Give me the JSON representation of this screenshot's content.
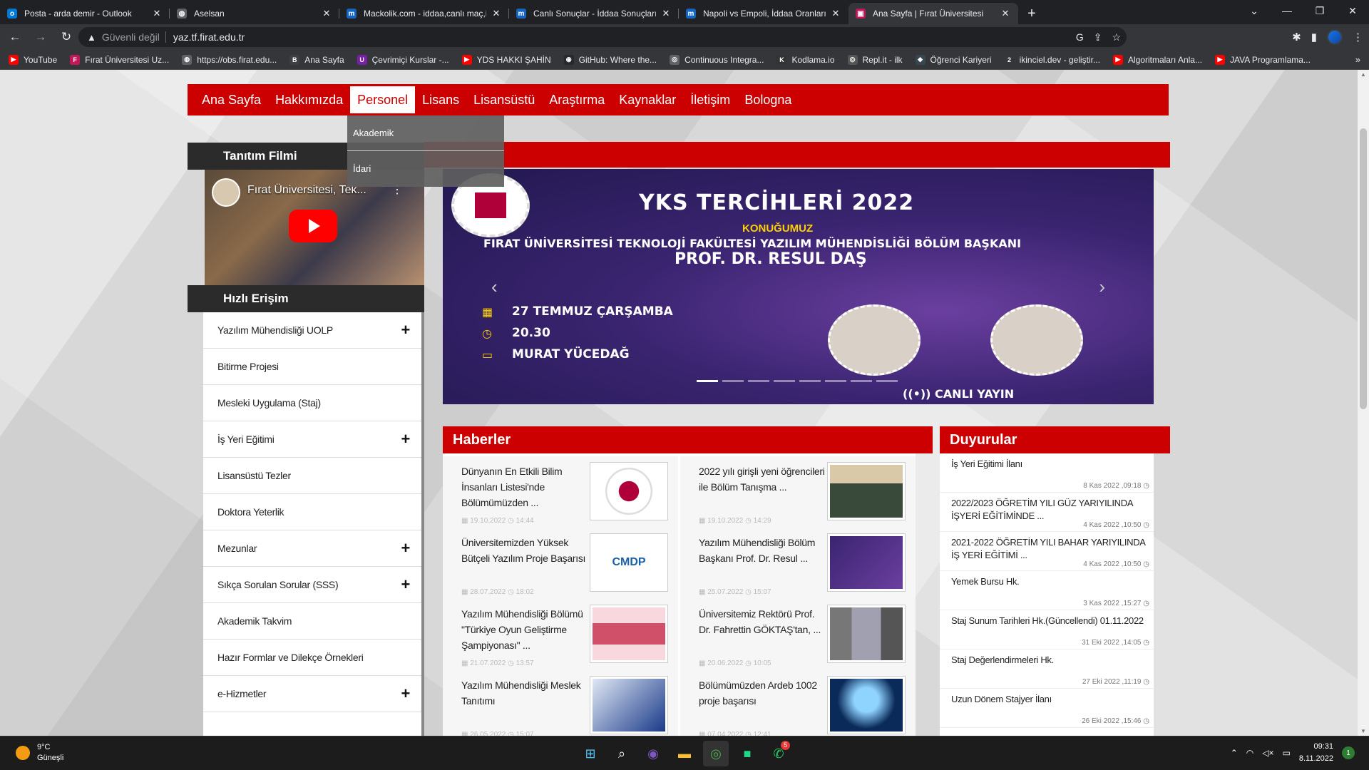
{
  "tabs": [
    {
      "title": "Posta - arda demir - Outlook",
      "icon": "outlook-icon",
      "color": "#0078d4",
      "glyph": "o"
    },
    {
      "title": "Aselsan",
      "icon": "globe-icon",
      "color": "#5f6368",
      "glyph": "◍"
    },
    {
      "title": "Mackolik.com - iddaa,canlı maç,iddaa",
      "icon": "mackolik-icon",
      "color": "#1565c0",
      "glyph": "m"
    },
    {
      "title": "Canlı Sonuçlar - İddaa Sonuçları",
      "icon": "mackolik-icon",
      "color": "#1565c0",
      "glyph": "m"
    },
    {
      "title": "Napoli vs Empoli, İddaa Oranları",
      "icon": "mackolik-icon",
      "color": "#1565c0",
      "glyph": "m"
    },
    {
      "title": "Ana Sayfa | Fırat Üniversitesi",
      "icon": "firat-icon",
      "color": "#c2185b",
      "glyph": "▣",
      "active": true
    }
  ],
  "toolbar": {
    "security": "Güvenli değil",
    "url": "yaz.tf.firat.edu.tr"
  },
  "bookmarks": [
    {
      "label": "YouTube",
      "color": "#ff0000",
      "glyph": "▶"
    },
    {
      "label": "Fırat Üniversitesi Uz...",
      "color": "#c2185b",
      "glyph": "F"
    },
    {
      "label": "https://obs.firat.edu...",
      "color": "#5f6368",
      "glyph": "◍"
    },
    {
      "label": "Ana Sayfa",
      "color": "#3c4043",
      "glyph": "B"
    },
    {
      "label": "Çevrimiçi Kurslar -...",
      "color": "#7b1fa2",
      "glyph": "U"
    },
    {
      "label": "YDS HAKKI ŞAHİN",
      "color": "#ff0000",
      "glyph": "▶"
    },
    {
      "label": "GitHub: Where the...",
      "color": "#24292e",
      "glyph": "◉"
    },
    {
      "label": "Continuous Integra...",
      "color": "#5f6368",
      "glyph": "◎"
    },
    {
      "label": "Kodlama.io",
      "color": "#333",
      "glyph": "K"
    },
    {
      "label": "Repl.it - ilk",
      "color": "#555",
      "glyph": "◎"
    },
    {
      "label": "Öğrenci Kariyeri",
      "color": "#37474f",
      "glyph": "◆"
    },
    {
      "label": "ikinciel.dev - geliştir...",
      "color": "#35363a",
      "glyph": "2"
    },
    {
      "label": "Algoritmaları Anla...",
      "color": "#ff0000",
      "glyph": "▶"
    },
    {
      "label": "JAVA Programlama...",
      "color": "#ff0000",
      "glyph": "▶"
    }
  ],
  "nav": {
    "items": [
      "Ana Sayfa",
      "Hakkımızda",
      "Personel",
      "Lisans",
      "Lisansüstü",
      "Araştırma",
      "Kaynaklar",
      "İletişim",
      "Bologna"
    ],
    "active": "Personel",
    "dropdown": [
      "Akademik",
      "İdari"
    ]
  },
  "sidebar": {
    "video_heading": "Tanıtım Filmi",
    "video_title": "Fırat Üniversitesi, Tek...",
    "quick_heading": "Hızlı Erişim",
    "items": [
      {
        "label": "Yazılım Mühendisliği UOLP",
        "expandable": true
      },
      {
        "label": "Bitirme Projesi",
        "expandable": false
      },
      {
        "label": "Mesleki Uygulama (Staj)",
        "expandable": false
      },
      {
        "label": "İş Yeri Eğitimi",
        "expandable": true
      },
      {
        "label": "Lisansüstü Tezler",
        "expandable": false
      },
      {
        "label": "Doktora Yeterlik",
        "expandable": false
      },
      {
        "label": "Mezunlar",
        "expandable": true
      },
      {
        "label": "Sıkça Sorulan Sorular (SSS)",
        "expandable": true
      },
      {
        "label": "Akademik Takvim",
        "expandable": false
      },
      {
        "label": "Hazır Formlar ve Dilekçe Örnekleri",
        "expandable": false
      },
      {
        "label": "e-Hizmetler",
        "expandable": true
      }
    ]
  },
  "slider": {
    "title": "YKS TERCİHLERİ 2022",
    "subtitle": "KONUĞUMUZ",
    "line1": "FIRAT ÜNİVERSİTESİ TEKNOLOJİ FAKÜLTESİ YAZILIM MÜHENDİSLİĞİ BÖLÜM BAŞKANI",
    "line2": "PROF. DR. RESUL DAŞ",
    "date": "27 TEMMUZ ÇARŞAMBA",
    "time": "20.30",
    "host": "MURAT YÜCEDAĞ",
    "live": "CANLI YAYIN",
    "slide_count": 8,
    "active_slide": 1
  },
  "news": {
    "heading": "Haberler",
    "items": [
      {
        "title": "Dünyanın En Etkili Bilim İnsanları Listesi'nde Bölümümüzden ...",
        "date": "19.10.2022",
        "time": "14:44"
      },
      {
        "title": "2022 yılı girişli yeni öğrencileri ile Bölüm Tanışma ...",
        "date": "19.10.2022",
        "time": "14:29"
      },
      {
        "title": "Üniversitemizden Yüksek Bütçeli Yazılım Proje Başarısı",
        "date": "28.07.2022",
        "time": "18:02"
      },
      {
        "title": "Yazılım Mühendisliği Bölüm Başkanı Prof. Dr. Resul ...",
        "date": "25.07.2022",
        "time": "15:07"
      },
      {
        "title": "Yazılım Mühendisliği Bölümü \"Türkiye Oyun Geliştirme Şampiyonası\" ...",
        "date": "21.07.2022",
        "time": "13:57"
      },
      {
        "title": "Üniversitemiz Rektörü Prof. Dr. Fahrettin GÖKTAŞ'tan, ...",
        "date": "20.06.2022",
        "time": "10:05"
      },
      {
        "title": "Yazılım Mühendisliği Meslek Tanıtımı",
        "date": "26.05.2022",
        "time": "15:07"
      },
      {
        "title": "Bölümümüzden Ardeb 1002 proje başarısı",
        "date": "07.04.2022",
        "time": "12:41"
      }
    ],
    "cmdp": "CMDP"
  },
  "announcements": {
    "heading": "Duyurular",
    "items": [
      {
        "title": "İş Yeri Eğitimi İlanı",
        "date": "8 Kas 2022 ,09:18"
      },
      {
        "title": "2022/2023 ÖĞRETİM YILI GÜZ YARIYILINDA İŞYERİ EĞİTİMİNDE ...",
        "date": "4 Kas 2022 ,10:50"
      },
      {
        "title": "2021-2022 ÖĞRETİM YILI BAHAR YARIYILINDA İŞ YERİ EĞİTİMİ ...",
        "date": "4 Kas 2022 ,10:50"
      },
      {
        "title": "Yemek Bursu Hk.",
        "date": "3 Kas 2022 ,15:27"
      },
      {
        "title": "Staj Sunum Tarihleri Hk.(Güncellendi) 01.11.2022",
        "date": "31 Eki 2022 ,14:05"
      },
      {
        "title": "Staj Değerlendirmeleri Hk.",
        "date": "27 Eki 2022 ,11:19"
      },
      {
        "title": "Uzun Dönem Stajyer İlanı",
        "date": "26 Eki 2022 ,15:46"
      }
    ]
  },
  "taskbar": {
    "temp": "9°C",
    "weather": "Güneşli",
    "time": "09:31",
    "date": "8.11.2022",
    "whatsapp_badge": "5",
    "notif_count": "1"
  }
}
